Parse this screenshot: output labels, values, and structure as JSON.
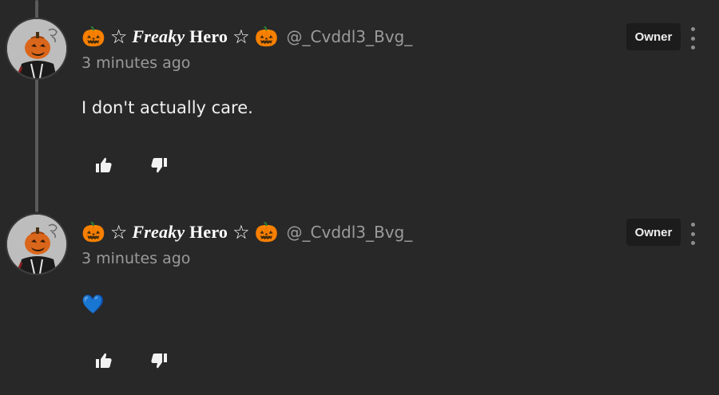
{
  "comments": [
    {
      "author": {
        "emoji_left": "🎃",
        "star_left": "☆",
        "name_fancy": "Freaky",
        "name_plain": "Hero",
        "star_right": "☆",
        "emoji_right": "🎃",
        "handle": "@_Cvddl3_Bvg_",
        "avatar_icon": "pumpkin-head-avatar"
      },
      "timestamp": "3 minutes ago",
      "text": "I don't actually care.",
      "badge": "Owner",
      "actions": {
        "like_icon": "thumbs-up-icon",
        "dislike_icon": "thumbs-down-icon",
        "more_icon": "vertical-dots-icon"
      }
    },
    {
      "author": {
        "emoji_left": "🎃",
        "star_left": "☆",
        "name_fancy": "Freaky",
        "name_plain": "Hero",
        "star_right": "☆",
        "emoji_right": "🎃",
        "handle": "@_Cvddl3_Bvg_",
        "avatar_icon": "pumpkin-head-avatar"
      },
      "timestamp": "3 minutes ago",
      "text": "💙",
      "badge": "Owner",
      "actions": {
        "like_icon": "thumbs-up-icon",
        "dislike_icon": "thumbs-down-icon",
        "more_icon": "vertical-dots-icon"
      }
    }
  ],
  "colors": {
    "background": "#282828",
    "thread_line": "#5a5a5a",
    "primary_text": "#f1f1f1",
    "secondary_text": "#9a9a9a",
    "badge_bg": "#1c1c1c",
    "pumpkin": "#e8711a",
    "heart": "#1e88e5"
  }
}
